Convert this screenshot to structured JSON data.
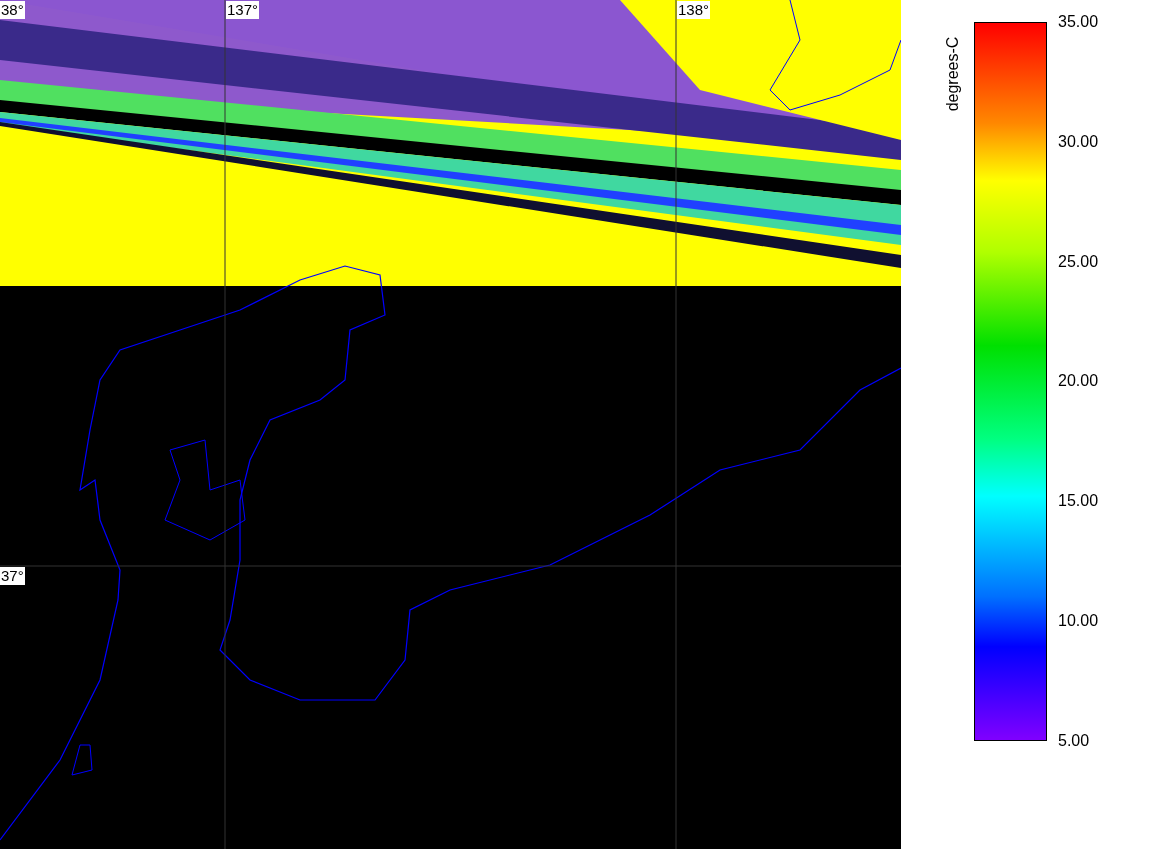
{
  "map": {
    "lon_labels": [
      "137°",
      "138°"
    ],
    "lat_labels": [
      "38°",
      "37°"
    ]
  },
  "colorbar": {
    "label": "degrees-C",
    "ticks": [
      "35.00",
      "30.00",
      "25.00",
      "20.00",
      "15.00",
      "10.00",
      "5.00"
    ]
  }
}
